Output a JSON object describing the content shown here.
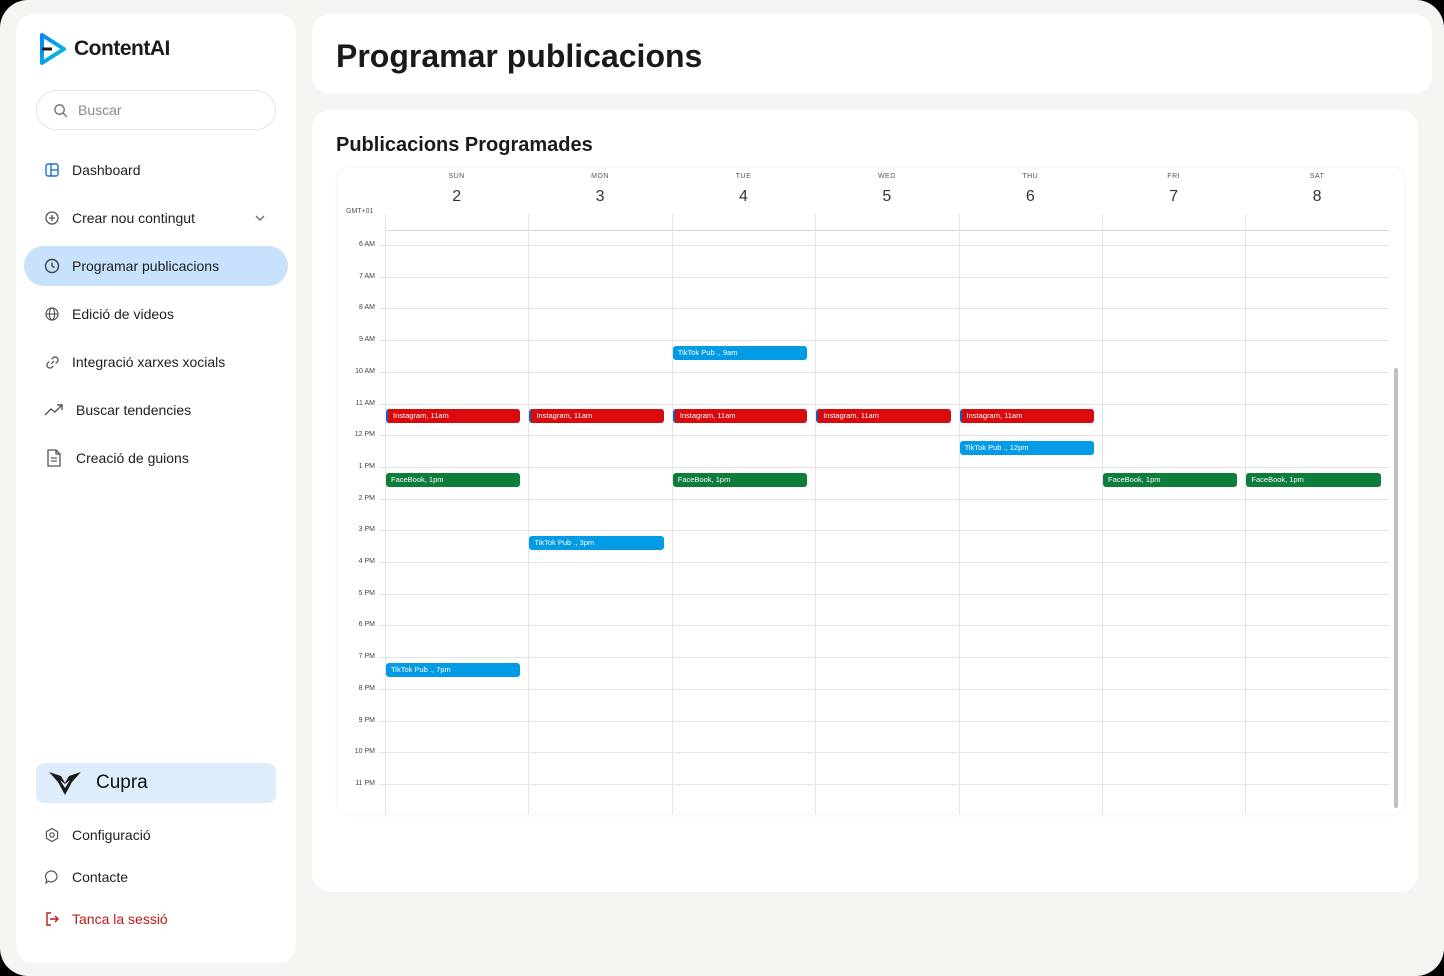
{
  "app": {
    "name": "ContentAI"
  },
  "search": {
    "placeholder": "Buscar"
  },
  "nav": [
    {
      "label": "Dashboard",
      "icon": "dashboard-icon"
    },
    {
      "label": "Crear nou contingut",
      "icon": "plus-circle-icon",
      "has_chevron": true
    },
    {
      "label": "Programar publicacions",
      "icon": "clock-icon",
      "active": true
    },
    {
      "label": "Edició de videos",
      "icon": "globe-icon"
    },
    {
      "label": "Integració xarxes xocials",
      "icon": "link-icon"
    },
    {
      "label": "Buscar tendencies",
      "icon": "trending-up-icon"
    },
    {
      "label": "Creació de guions",
      "icon": "document-icon"
    }
  ],
  "brand": {
    "name": "Cupra",
    "icon": "cupra-logo-icon"
  },
  "bottom_nav": [
    {
      "label": "Configuració",
      "icon": "settings-icon"
    },
    {
      "label": "Contacte",
      "icon": "chat-bubble-icon"
    },
    {
      "label": "Tanca la sessió",
      "icon": "logout-icon",
      "color": "#c0181b"
    }
  ],
  "header": {
    "title": "Programar publicacions"
  },
  "main": {
    "section_title": "Publicacions Programades"
  },
  "calendar": {
    "timezone": "GMT+01",
    "days": [
      {
        "name": "SUN",
        "num": "2"
      },
      {
        "name": "MON",
        "num": "3"
      },
      {
        "name": "TUE",
        "num": "4"
      },
      {
        "name": "WED",
        "num": "5"
      },
      {
        "name": "THU",
        "num": "6"
      },
      {
        "name": "FRI",
        "num": "7"
      },
      {
        "name": "SAT",
        "num": "8"
      }
    ],
    "hours": [
      "6 AM",
      "7 AM",
      "8 AM",
      "9 AM",
      "10 AM",
      "11 AM",
      "12 PM",
      "1 PM",
      "2 PM",
      "3 PM",
      "4 PM",
      "5 PM",
      "6 PM",
      "7 PM",
      "8 PM",
      "9 PM",
      "10 PM",
      "11 PM"
    ],
    "first_hour": 6,
    "colors": {
      "instagram": "#d80a0e",
      "facebook": "#0d7d3c",
      "tiktok": "#039be5"
    },
    "events": [
      {
        "day": 2,
        "hour": 9,
        "label": "TikTok Pub ., 9am",
        "type": "tiktok"
      },
      {
        "day": 0,
        "hour": 11,
        "label": "Instagram, 11am",
        "type": "instagram"
      },
      {
        "day": 1,
        "hour": 11,
        "label": "Instagram, 11am",
        "type": "instagram"
      },
      {
        "day": 2,
        "hour": 11,
        "label": "Instagram, 11am",
        "type": "instagram"
      },
      {
        "day": 3,
        "hour": 11,
        "label": "Instagram, 11am",
        "type": "instagram"
      },
      {
        "day": 4,
        "hour": 11,
        "label": "Instagram, 11am",
        "type": "instagram"
      },
      {
        "day": 4,
        "hour": 12,
        "label": "TikTok Pub ., 12pm",
        "type": "tiktok"
      },
      {
        "day": 0,
        "hour": 13,
        "label": "FaceBook, 1pm",
        "type": "facebook"
      },
      {
        "day": 2,
        "hour": 13,
        "label": "FaceBook, 1pm",
        "type": "facebook"
      },
      {
        "day": 5,
        "hour": 13,
        "label": "FaceBook, 1pm",
        "type": "facebook"
      },
      {
        "day": 6,
        "hour": 13,
        "label": "FaceBook, 1pm",
        "type": "facebook"
      },
      {
        "day": 1,
        "hour": 15,
        "label": "TikTok Pub ., 3pm",
        "type": "tiktok"
      },
      {
        "day": 0,
        "hour": 19,
        "label": "TikTok Pub ., 7pm",
        "type": "tiktok"
      }
    ]
  }
}
